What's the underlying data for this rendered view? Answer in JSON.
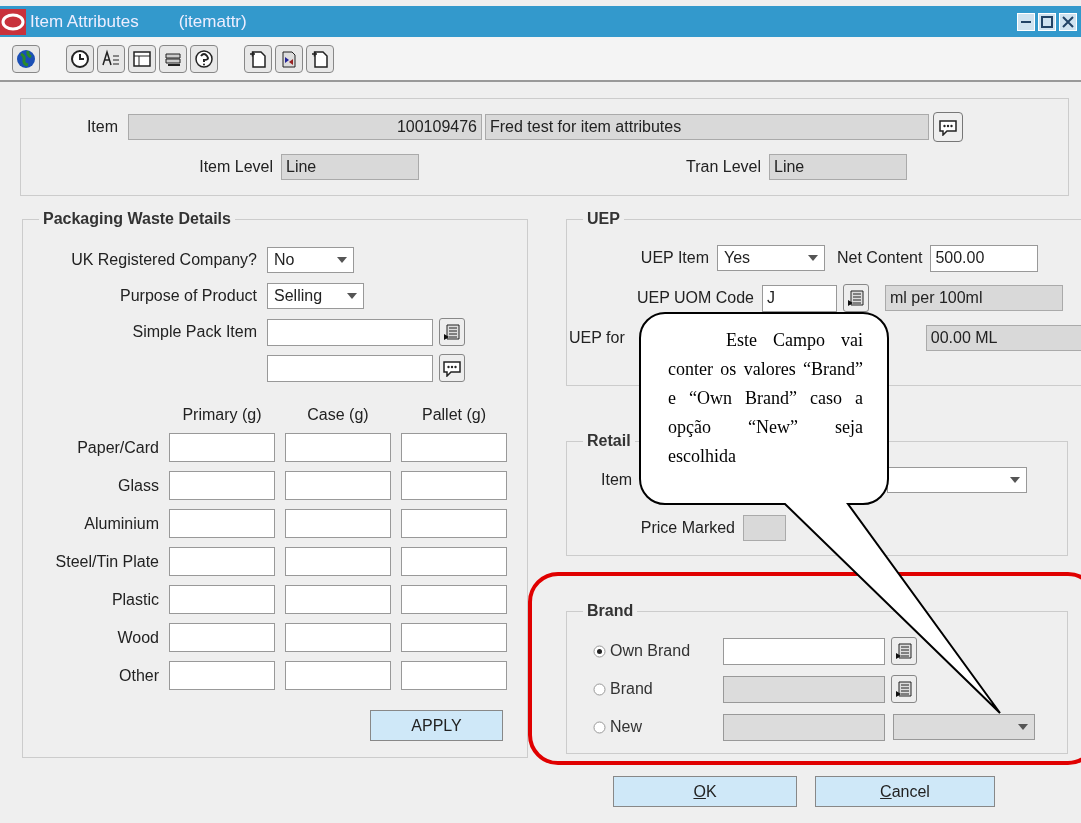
{
  "window": {
    "title": "Item Attributes",
    "form_name": "(itemattr)"
  },
  "item": {
    "label": "Item",
    "number": "100109476",
    "description": "Fred test for item attributes"
  },
  "levels": [
    {
      "label": "Item Level",
      "value": "Line"
    },
    {
      "label": "Tran Level",
      "value": "Line"
    }
  ],
  "packaging": {
    "title": "Packaging Waste Details",
    "selects": [
      {
        "label": "UK Registered Company?",
        "value": "No"
      },
      {
        "label": "Purpose of Product",
        "value": "Selling"
      }
    ],
    "simple_pack": {
      "label": "Simple Pack Item"
    },
    "columns": [
      "Primary (g)",
      "Case (g)",
      "Pallet (g)"
    ],
    "rows": [
      "Paper/Card",
      "Glass",
      "Aluminium",
      "Steel/Tin Plate",
      "Plastic",
      "Wood",
      "Other"
    ],
    "apply": "APPLY"
  },
  "uep": {
    "title": "UEP",
    "uep_item": {
      "label": "UEP Item",
      "value": "Yes"
    },
    "net_content": {
      "label": "Net Content",
      "value": "500.00"
    },
    "uom_code": {
      "label": "UEP UOM Code",
      "value": "J",
      "description": "ml per 100ml"
    },
    "uep_for": {
      "label": "UEP for",
      "value": "00.00 ML"
    }
  },
  "retail": {
    "title": "Retail",
    "item_label": "Item",
    "price_marked": {
      "label": "Price Marked"
    }
  },
  "brand": {
    "title": "Brand",
    "options": [
      {
        "label": "Own Brand",
        "selected": true,
        "disabled": false,
        "kind": "lov"
      },
      {
        "label": "Brand",
        "selected": false,
        "disabled": true,
        "kind": "lov"
      },
      {
        "label": "New",
        "selected": false,
        "disabled": true,
        "kind": "list"
      }
    ]
  },
  "buttons": [
    {
      "label": "OK"
    },
    {
      "label": "Cancel"
    }
  ],
  "callout": {
    "text": "Este Campo vai conter os valores “Brand” e “Own Brand” caso a opção “New” seja escolhida"
  }
}
